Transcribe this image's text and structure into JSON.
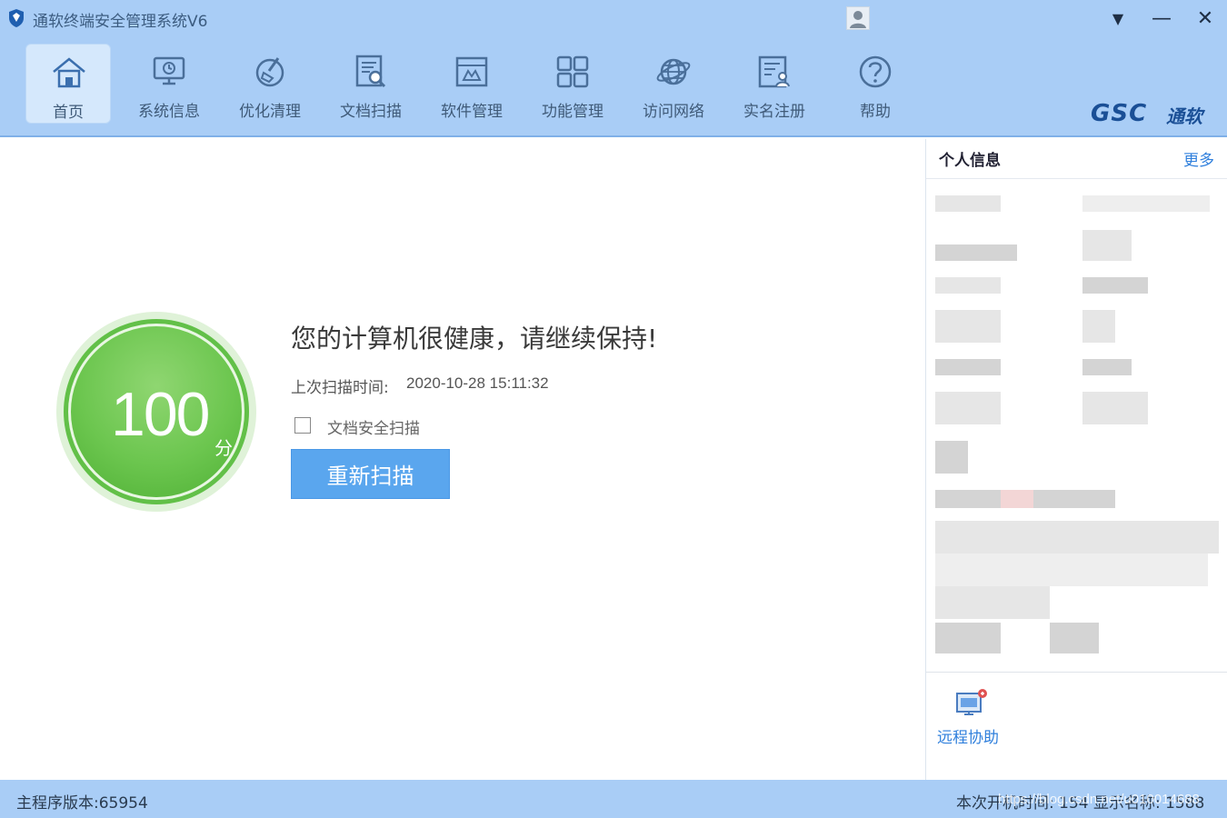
{
  "window": {
    "title": "通软终端安全管理系统V6",
    "controls": {
      "menu": "▼",
      "minimize": "—",
      "close": "✕"
    }
  },
  "toolbar": {
    "items": [
      {
        "label": "首页",
        "icon": "home-icon"
      },
      {
        "label": "系统信息",
        "icon": "monitor-icon"
      },
      {
        "label": "优化清理",
        "icon": "broom-icon"
      },
      {
        "label": "文档扫描",
        "icon": "document-scan-icon"
      },
      {
        "label": "软件管理",
        "icon": "software-box-icon"
      },
      {
        "label": "功能管理",
        "icon": "grid-icon"
      },
      {
        "label": "访问网络",
        "icon": "globe-icon"
      },
      {
        "label": "实名注册",
        "icon": "id-card-icon"
      },
      {
        "label": "帮助",
        "icon": "help-icon"
      }
    ],
    "active_index": 0,
    "brand": "GSC",
    "brand_cn": "通软"
  },
  "health": {
    "score": "100",
    "unit": "分",
    "headline": "您的计算机很健康，请继续保持!",
    "last_scan_label": "上次扫描时间:",
    "last_scan_value": "2020-10-28 15:11:32",
    "doc_scan_checkbox_label": "文档安全扫描",
    "doc_scan_checked": false,
    "rescan_button": "重新扫描"
  },
  "side_panel": {
    "title": "个人信息",
    "more": "更多",
    "remote_assist": "远程协助"
  },
  "statusbar": {
    "version": "主程序版本:65954",
    "right_text": "本次开机时间: 154 显示名称: 1588",
    "watermark": "https://blog.csdn.net/u010014688"
  },
  "colors": {
    "chrome_blue": "#a9cdf6",
    "accent_blue": "#5aa6ee",
    "score_green": "#62c048",
    "link_blue": "#2f7fdc"
  }
}
